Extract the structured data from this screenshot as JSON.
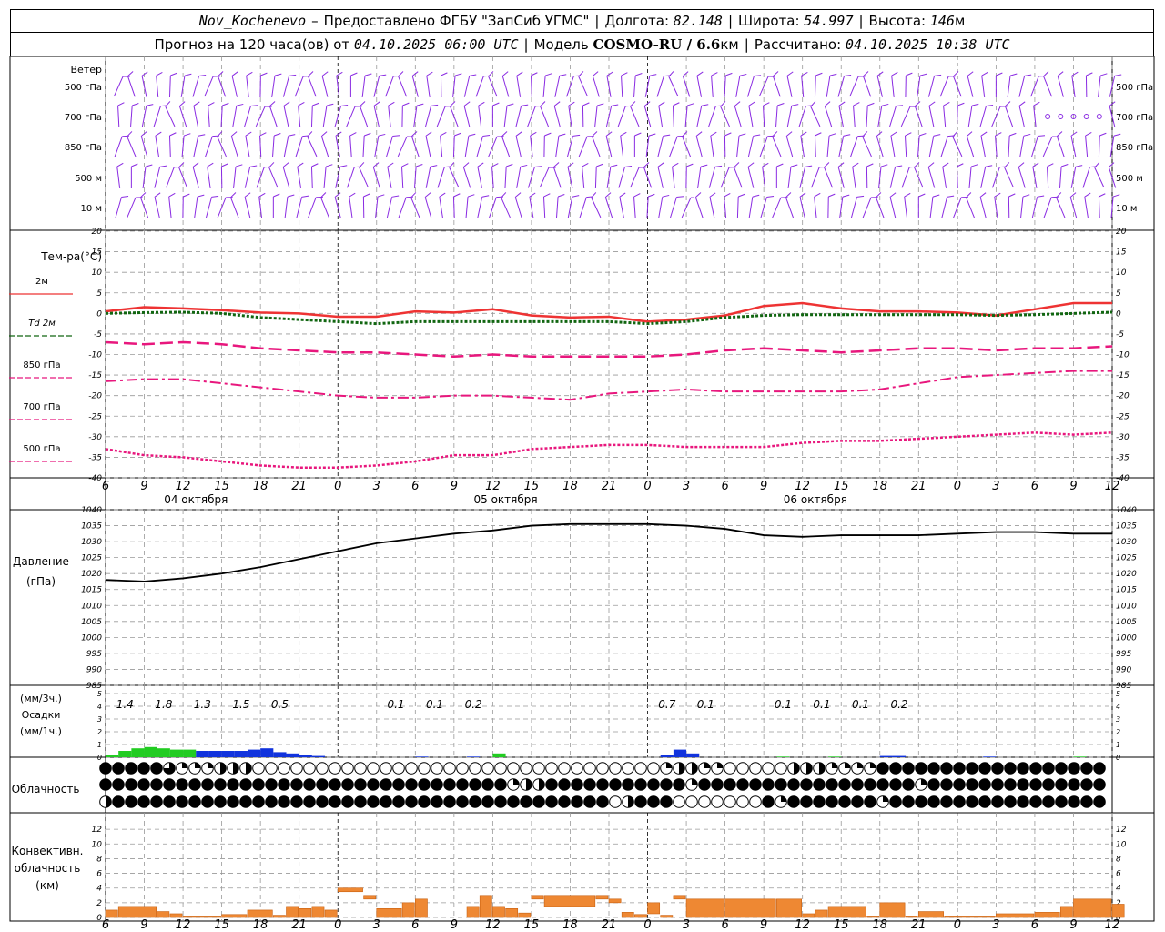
{
  "header": {
    "station": "Nov_Kochenevo",
    "dash": "–",
    "provider": "Предоставлено ФГБУ \"ЗапСиб УГМС\"",
    "lon_label": "Долгота:",
    "lon": "82.148",
    "lat_label": "Широта:",
    "lat": "54.997",
    "alt_label": "Высота:",
    "alt": "146",
    "alt_unit": "м",
    "forecast_prefix": "Прогноз на 120 часа(ов)  от",
    "forecast_start": "04.10.2025 06:00 UTC",
    "model_label": "Модель",
    "model": "COSMO-RU / 6.6",
    "model_unit": "км",
    "computed_label": "Рассчитано:",
    "computed": "04.10.2025 10:38 UTC"
  },
  "time_axis": {
    "hour_ticks": [
      "6",
      "9",
      "12",
      "15",
      "18",
      "21",
      "0",
      "3",
      "6",
      "9",
      "12",
      "15",
      "18",
      "21",
      "0",
      "3",
      "6",
      "9",
      "12",
      "15",
      "18",
      "21",
      "0",
      "3",
      "6",
      "9",
      "12"
    ],
    "dates": [
      "04 октября",
      "05 октября",
      "06 октября"
    ]
  },
  "wind_panel": {
    "title": "Ветер",
    "levels": [
      "500 гПа",
      "700 гПа",
      "850 гПа",
      "500 м",
      "10 м"
    ]
  },
  "chart_data": [
    {
      "type": "line",
      "title": "Тем-ра(°C)",
      "ylim": [
        -40,
        20
      ],
      "y_ticks": [
        "20",
        "15",
        "10",
        "5",
        "0",
        "-5",
        "-10",
        "-15",
        "-20",
        "-25",
        "-30",
        "-35",
        "-40"
      ],
      "x": [
        6,
        9,
        12,
        15,
        18,
        21,
        24,
        27,
        30,
        33,
        36,
        39,
        42,
        45,
        48,
        51,
        54,
        57,
        60,
        63,
        66,
        69,
        72,
        75,
        78,
        81,
        84
      ],
      "series": [
        {
          "name": "2м",
          "color": "#ee3333",
          "values": [
            0.5,
            1.5,
            1.2,
            0.8,
            0.2,
            0.0,
            -0.8,
            -0.8,
            0.5,
            0.2,
            1.0,
            -0.5,
            -1.0,
            -0.8,
            -2.0,
            -1.5,
            -0.5,
            1.8,
            2.5,
            1.2,
            0.5,
            0.5,
            0.2,
            -0.5,
            1.0,
            2.5,
            2.5
          ]
        },
        {
          "name": "Td 2м",
          "color": "#116611",
          "values": [
            0.0,
            0.2,
            0.3,
            0.0,
            -1.0,
            -1.5,
            -2.0,
            -2.5,
            -2.0,
            -2.0,
            -2.0,
            -2.0,
            -2.0,
            -2.0,
            -2.5,
            -2.0,
            -1.0,
            -0.5,
            -0.3,
            -0.3,
            -0.3,
            -0.3,
            -0.3,
            -0.5,
            -0.3,
            0.0,
            0.3
          ]
        },
        {
          "name": "850 гПа",
          "color": "#e8177d",
          "values": [
            -7,
            -7.5,
            -7,
            -7.5,
            -8.5,
            -9,
            -9.5,
            -9.5,
            -10,
            -10.5,
            -10,
            -10.5,
            -10.5,
            -10.5,
            -10.5,
            -10,
            -9,
            -8.5,
            -9,
            -9.5,
            -9,
            -8.5,
            -8.5,
            -9,
            -8.5,
            -8.5,
            -8
          ]
        },
        {
          "name": "700 гПа",
          "color": "#e8177d",
          "values": [
            -16.5,
            -16,
            -16,
            -17,
            -18,
            -19,
            -20,
            -20.5,
            -20.5,
            -20,
            -20,
            -20.5,
            -21,
            -19.5,
            -19,
            -18.5,
            -19,
            -19,
            -19,
            -19,
            -18.5,
            -17,
            -15.5,
            -15,
            -14.5,
            -14,
            -14
          ]
        },
        {
          "name": "500 гПа",
          "color": "#e8177d",
          "values": [
            -33,
            -34.5,
            -35,
            -36,
            -37,
            -37.5,
            -37.5,
            -37,
            -36,
            -34.5,
            -34.5,
            -33,
            -32.5,
            -32,
            -32,
            -32.5,
            -32.5,
            -32.5,
            -31.5,
            -31,
            -31,
            -30.5,
            -30,
            -29.5,
            -29,
            -29.5,
            -29
          ]
        }
      ]
    },
    {
      "type": "line",
      "title": "Давление",
      "ylabel": "(гПа)",
      "ylim": [
        985,
        1040
      ],
      "y_ticks": [
        "1040",
        "1035",
        "1030",
        "1025",
        "1020",
        "1015",
        "1010",
        "1005",
        "1000",
        "995",
        "990",
        "985"
      ],
      "x": [
        6,
        9,
        12,
        15,
        18,
        21,
        24,
        27,
        30,
        33,
        36,
        39,
        42,
        45,
        48,
        51,
        54,
        57,
        60,
        63,
        66,
        69,
        72,
        75,
        78,
        81,
        84
      ],
      "series": [
        {
          "name": "Давление",
          "color": "#000000",
          "values": [
            1018,
            1017.5,
            1018.5,
            1020,
            1022,
            1024.5,
            1027,
            1029.5,
            1031,
            1032.5,
            1033.5,
            1035,
            1035.5,
            1035.5,
            1035.5,
            1035,
            1034,
            1032,
            1031.5,
            1032,
            1032,
            1032,
            1032.5,
            1033,
            1033,
            1032.5,
            1032.5
          ]
        }
      ]
    },
    {
      "type": "bar",
      "title": "Осадки",
      "ylabel": "(мм/3ч.) (мм/1ч.)",
      "ylim": [
        0,
        5
      ],
      "y_ticks": [
        "5",
        "4",
        "3",
        "2",
        "1",
        "0"
      ],
      "totals_3h": [
        {
          "h": 7.5,
          "label": "1.4"
        },
        {
          "h": 10.5,
          "label": "1.8"
        },
        {
          "h": 13.5,
          "label": "1.3"
        },
        {
          "h": 16.5,
          "label": "1.5"
        },
        {
          "h": 19.5,
          "label": "0.5"
        },
        {
          "h": 28.5,
          "label": "0.1"
        },
        {
          "h": 31.5,
          "label": "0.1"
        },
        {
          "h": 34.5,
          "label": "0.2"
        },
        {
          "h": 49.5,
          "label": "0.7"
        },
        {
          "h": 52.5,
          "label": "0.1"
        },
        {
          "h": 58.5,
          "label": "0.1"
        },
        {
          "h": 61.5,
          "label": "0.1"
        },
        {
          "h": 64.5,
          "label": "0.1"
        },
        {
          "h": 67.5,
          "label": "0.2"
        }
      ],
      "hourly": [
        {
          "h": 6,
          "v": 0.2,
          "t": "rain"
        },
        {
          "h": 7,
          "v": 0.5,
          "t": "rain"
        },
        {
          "h": 8,
          "v": 0.7,
          "t": "rain"
        },
        {
          "h": 9,
          "v": 0.8,
          "t": "rain"
        },
        {
          "h": 10,
          "v": 0.7,
          "t": "rain"
        },
        {
          "h": 11,
          "v": 0.6,
          "t": "rain"
        },
        {
          "h": 12,
          "v": 0.6,
          "t": "rain"
        },
        {
          "h": 13,
          "v": 0.5,
          "t": "snow"
        },
        {
          "h": 14,
          "v": 0.5,
          "t": "snow"
        },
        {
          "h": 15,
          "v": 0.5,
          "t": "snow"
        },
        {
          "h": 16,
          "v": 0.5,
          "t": "snow"
        },
        {
          "h": 17,
          "v": 0.6,
          "t": "snow"
        },
        {
          "h": 18,
          "v": 0.7,
          "t": "snow"
        },
        {
          "h": 19,
          "v": 0.4,
          "t": "snow"
        },
        {
          "h": 20,
          "v": 0.3,
          "t": "snow"
        },
        {
          "h": 21,
          "v": 0.2,
          "t": "snow"
        },
        {
          "h": 22,
          "v": 0.1,
          "t": "snow"
        },
        {
          "h": 30,
          "v": 0.05,
          "t": "snow"
        },
        {
          "h": 34,
          "v": 0.05,
          "t": "snow"
        },
        {
          "h": 36,
          "v": 0.3,
          "t": "rain"
        },
        {
          "h": 49,
          "v": 0.2,
          "t": "snow"
        },
        {
          "h": 50,
          "v": 0.6,
          "t": "snow"
        },
        {
          "h": 51,
          "v": 0.3,
          "t": "snow"
        },
        {
          "h": 58,
          "v": 0.05,
          "t": "rain"
        },
        {
          "h": 62,
          "v": 0.05,
          "t": "rain"
        },
        {
          "h": 66,
          "v": 0.1,
          "t": "snow"
        },
        {
          "h": 67,
          "v": 0.1,
          "t": "snow"
        },
        {
          "h": 74,
          "v": 0.05,
          "t": "snow"
        },
        {
          "h": 81,
          "v": 0.05,
          "t": "rain"
        }
      ]
    },
    {
      "type": "table",
      "title": "Облачность",
      "rows": [
        "FFFFFtqqqhhhEEEEEEEEEEEEEEEEEEEEEEEEEEEEEEEEqhhqqEEEEEhhhqqqqFFFFFFFFFFFFFFFFFFEFFEEEEEEEEEEEEEEEEEEEEEEEEEEEhhhhhhhhEEEE",
        "FFFFFFFFFFFFFFFFFFFFFFFFFFFFFFFFqhhFFFFFFFFFFFqFFFFFFFFFFFFFFFFFqFFFFFFFFFFFFFFFFFFFFFFFFFFFFFFFFFqFFFFFFFFFFFFFFFFFFFFFFF",
        "hFFFFFFFFFFFFFFFFFFFFFFFFFFFFFFFFFFFFFFFEhFFFEEEEEEEFqFFFFFFFqFFFFFFFFFFFFFFFFFFFFFFFFFFFFFFFFFFFFFFFFFFFFFFFFFFFFFFFFFF"
      ]
    },
    {
      "type": "bar",
      "title": "Конвективн. облачность",
      "ylabel": "(км)",
      "ylim": [
        0,
        14
      ],
      "y_ticks": [
        "12",
        "10",
        "8",
        "6",
        "4",
        "2",
        "0"
      ],
      "segments": [
        {
          "h0": 6,
          "h1": 7,
          "b": 0,
          "t": 1
        },
        {
          "h0": 7,
          "h1": 10,
          "b": 0,
          "t": 1.5
        },
        {
          "h0": 10,
          "h1": 11,
          "b": 0,
          "t": 0.8
        },
        {
          "h0": 11,
          "h1": 12,
          "b": 0,
          "t": 0.5
        },
        {
          "h0": 12,
          "h1": 15,
          "b": 0,
          "t": 0.2
        },
        {
          "h0": 15,
          "h1": 17,
          "b": 0,
          "t": 0.4
        },
        {
          "h0": 17,
          "h1": 19,
          "b": 0,
          "t": 1
        },
        {
          "h0": 19,
          "h1": 20,
          "b": 0,
          "t": 0.3
        },
        {
          "h0": 20,
          "h1": 21,
          "b": 0,
          "t": 1.5
        },
        {
          "h0": 21,
          "h1": 22,
          "b": 0,
          "t": 1.2
        },
        {
          "h0": 22,
          "h1": 23,
          "b": 0,
          "t": 1.5
        },
        {
          "h0": 23,
          "h1": 24,
          "b": 0,
          "t": 1
        },
        {
          "h0": 24,
          "h1": 26,
          "b": 3.5,
          "t": 4
        },
        {
          "h0": 26,
          "h1": 27,
          "b": 2.5,
          "t": 3
        },
        {
          "h0": 27,
          "h1": 29,
          "b": 0,
          "t": 1.2
        },
        {
          "h0": 29,
          "h1": 30,
          "b": 0,
          "t": 2
        },
        {
          "h0": 30,
          "h1": 31,
          "b": 0,
          "t": 2.5
        },
        {
          "h0": 34,
          "h1": 35,
          "b": 0,
          "t": 1.5
        },
        {
          "h0": 35,
          "h1": 36,
          "b": 0,
          "t": 3
        },
        {
          "h0": 36,
          "h1": 37,
          "b": 0,
          "t": 1.5
        },
        {
          "h0": 37,
          "h1": 38,
          "b": 0,
          "t": 1.2
        },
        {
          "h0": 38,
          "h1": 39,
          "b": 0,
          "t": 0.6
        },
        {
          "h0": 39,
          "h1": 40,
          "b": 2.5,
          "t": 3
        },
        {
          "h0": 40,
          "h1": 44,
          "b": 1.5,
          "t": 3
        },
        {
          "h0": 44,
          "h1": 45,
          "b": 2.5,
          "t": 3
        },
        {
          "h0": 45,
          "h1": 46,
          "b": 2,
          "t": 2.5
        },
        {
          "h0": 46,
          "h1": 47,
          "b": 0,
          "t": 0.7
        },
        {
          "h0": 47,
          "h1": 48,
          "b": 0,
          "t": 0.4
        },
        {
          "h0": 48,
          "h1": 49,
          "b": 0.5,
          "t": 2
        },
        {
          "h0": 49,
          "h1": 50,
          "b": 0,
          "t": 0.3
        },
        {
          "h0": 50,
          "h1": 51,
          "b": 2.5,
          "t": 3
        },
        {
          "h0": 51,
          "h1": 54,
          "b": 0,
          "t": 2.5
        },
        {
          "h0": 54,
          "h1": 58,
          "b": 0,
          "t": 2.5
        },
        {
          "h0": 58,
          "h1": 60,
          "b": 0,
          "t": 2.5
        },
        {
          "h0": 60,
          "h1": 61,
          "b": 0,
          "t": 0.5
        },
        {
          "h0": 61,
          "h1": 62,
          "b": 0,
          "t": 1
        },
        {
          "h0": 62,
          "h1": 65,
          "b": 0,
          "t": 1.5
        },
        {
          "h0": 65,
          "h1": 66,
          "b": 0,
          "t": 0.2
        },
        {
          "h0": 66,
          "h1": 68,
          "b": 0,
          "t": 2
        },
        {
          "h0": 68,
          "h1": 69,
          "b": 0,
          "t": 0.2
        },
        {
          "h0": 69,
          "h1": 71,
          "b": 0,
          "t": 0.8
        },
        {
          "h0": 71,
          "h1": 72,
          "b": 0,
          "t": 0.2
        },
        {
          "h0": 72,
          "h1": 75,
          "b": 0,
          "t": 0.2
        },
        {
          "h0": 75,
          "h1": 78,
          "b": 0,
          "t": 0.5
        },
        {
          "h0": 78,
          "h1": 80,
          "b": 0,
          "t": 0.7
        },
        {
          "h0": 80,
          "h1": 81,
          "b": 0,
          "t": 1.5
        },
        {
          "h0": 81,
          "h1": 84,
          "b": 0,
          "t": 2.5
        },
        {
          "h0": 84,
          "h1": 85,
          "b": 0,
          "t": 1.8
        }
      ]
    }
  ],
  "colors": {
    "wind": "#8a2be2",
    "t2m": "#ee3333",
    "td2m": "#116611",
    "upper": "#e8177d",
    "rain": "#22cc22",
    "snow": "#1133dd",
    "convective": "#ee8833",
    "grid": "#999999"
  }
}
